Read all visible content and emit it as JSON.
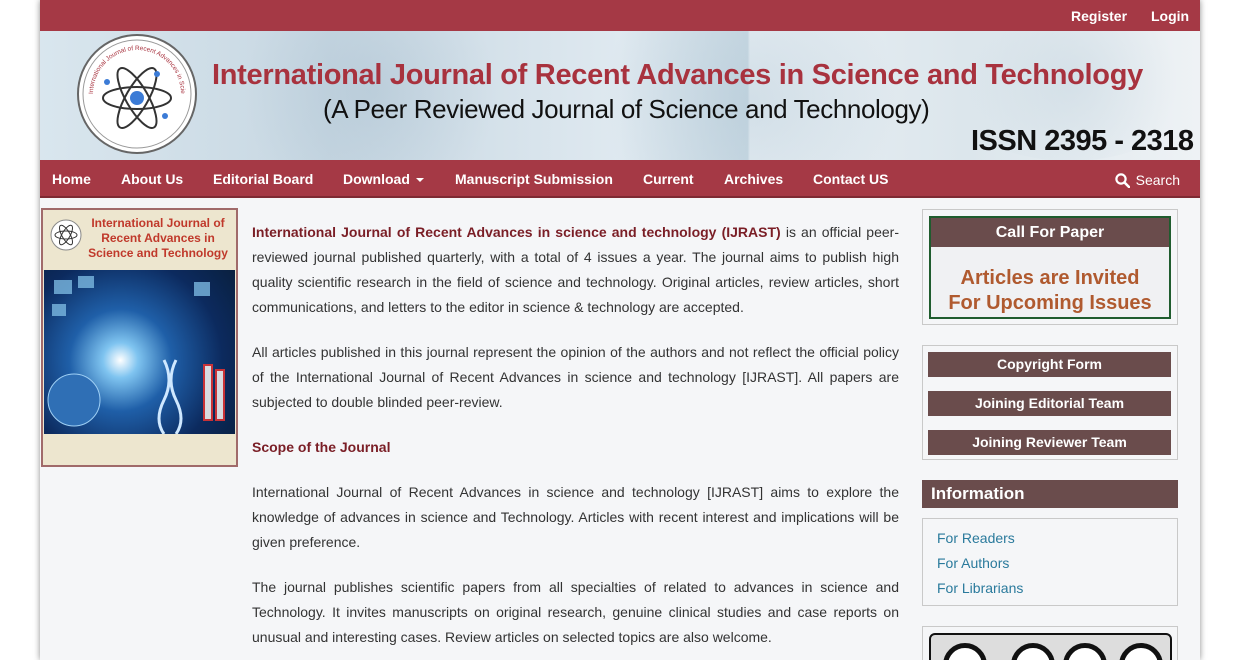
{
  "topbar": {
    "register": "Register",
    "login": "Login"
  },
  "banner": {
    "title": "International Journal of Recent Advances in Science and Technology",
    "subtitle": "(A Peer Reviewed Journal of Science and Technology)",
    "issn": "ISSN 2395 - 2318",
    "logo_text": "International Journal of Recent Advances in Science and Technology"
  },
  "nav": {
    "items": [
      "Home",
      "About Us",
      "Editorial Board",
      "Download",
      "Manuscript Submission",
      "Current",
      "Archives",
      "Contact US"
    ],
    "search": "Search"
  },
  "cover": {
    "title": "International Journal of Recent Advances in Science and Technology"
  },
  "main": {
    "p1_bold": "International Journal of Recent Advances in science and technology (IJRAST)",
    "p1_rest": " is an official peer-reviewed journal published quarterly, with a total of 4 issues a year. The journal aims to publish high quality scientific research in the field of science and technology. Original articles, review articles, short communications, and letters to the editor in science & technology are accepted.",
    "p2": "All articles published in this journal represent the opinion of the authors and not reflect the official policy of the International Journal of Recent Advances in science and technology [IJRAST]. All papers are subjected to double blinded peer-review.",
    "scope_heading": "Scope of the Journal",
    "p3": "International Journal of Recent Advances in science and technology [IJRAST] aims to explore the knowledge of advances in science and Technology. Articles with recent interest and implications will be given preference.",
    "p4": " The journal publishes scientific papers from all specialties of related to advances in science and Technology. It invites manuscripts on original research, genuine clinical studies and case reports on unusual and interesting cases. Review articles on selected topics are also welcome."
  },
  "sidebar": {
    "call_for_paper": {
      "heading": "Call For Paper",
      "line1": "Articles are Invited",
      "line2": "For Upcoming Issues"
    },
    "buttons": [
      "Copyright Form",
      "Joining Editorial Team",
      "Joining Reviewer Team"
    ],
    "information": {
      "heading": "Information",
      "links": [
        "For Readers",
        "For Authors",
        "For Librarians"
      ]
    }
  }
}
